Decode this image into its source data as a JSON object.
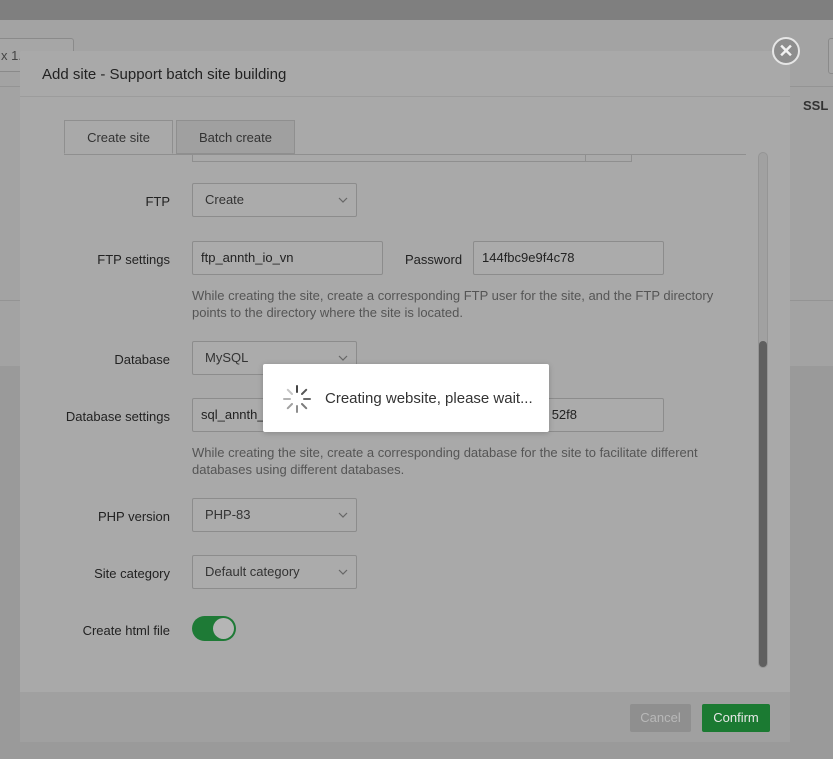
{
  "background": {
    "select_value": "x 1...",
    "column_ssl": "SSL"
  },
  "modal": {
    "title": "Add site - Support batch site building",
    "close_icon": "close-icon",
    "tabs": [
      {
        "label": "Create site",
        "active": true
      },
      {
        "label": "Batch create",
        "active": false
      }
    ],
    "form": {
      "ftp": {
        "label": "FTP",
        "value": "Create"
      },
      "ftp_settings": {
        "label": "FTP settings",
        "username": "ftp_annth_io_vn",
        "password_label": "Password",
        "password": "144fbc9e9f4c78",
        "hint": "While creating the site, create a corresponding FTP user for the site, and the FTP directory points to the directory where the site is located."
      },
      "database": {
        "label": "Database",
        "value": "MySQL"
      },
      "database_settings": {
        "label": "Database settings",
        "username": "sql_annth_",
        "password_partial": "52f8",
        "hint": "While creating the site, create a corresponding database for the site to facilitate different databases using different databases."
      },
      "php_version": {
        "label": "PHP version",
        "value": "PHP-83"
      },
      "site_category": {
        "label": "Site category",
        "value": "Default category"
      },
      "create_html": {
        "label": "Create html file",
        "enabled": true
      }
    },
    "footer": {
      "cancel_label": "Cancel",
      "confirm_label": "Confirm"
    }
  },
  "loading": {
    "text": "Creating website, please wait..."
  },
  "colors": {
    "accent_green": "#20a53a",
    "overlay": "#808080"
  }
}
